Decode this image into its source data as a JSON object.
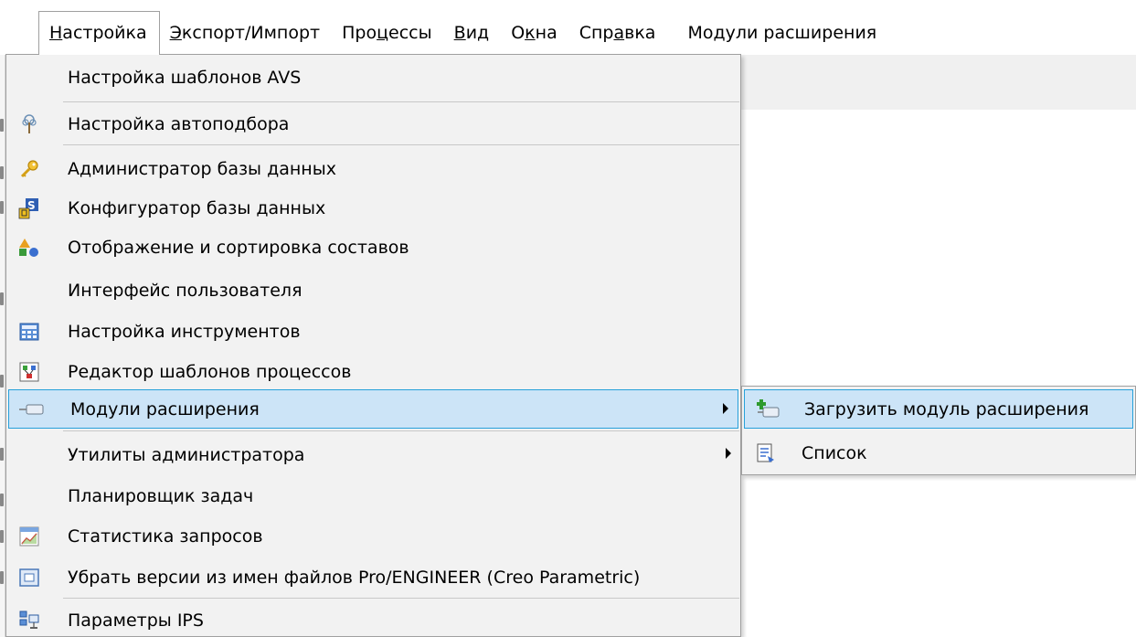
{
  "menubar": {
    "items": [
      {
        "pre": "",
        "mnemonic": "Н",
        "post": "астройка"
      },
      {
        "pre": "",
        "mnemonic": "Э",
        "post": "кспорт/Импорт"
      },
      {
        "pre": "Про",
        "mnemonic": "ц",
        "post": "ессы"
      },
      {
        "pre": "",
        "mnemonic": "В",
        "post": "ид"
      },
      {
        "pre": "О",
        "mnemonic": "к",
        "post": "на"
      },
      {
        "pre": "Спр",
        "mnemonic": "а",
        "post": "вка"
      },
      {
        "pre": "Модули расширения",
        "mnemonic": "",
        "post": ""
      }
    ]
  },
  "dropdown": {
    "items": [
      {
        "label": "Настройка шаблонов AVS",
        "icon": "none"
      },
      {
        "label": "Настройка автоподбора",
        "icon": "tree-icon"
      },
      {
        "label": "Администратор базы данных",
        "icon": "key-icon"
      },
      {
        "label": "Конфигуратор базы данных",
        "icon": "db-config-icon"
      },
      {
        "label": "Отображение и сортировка составов",
        "icon": "shapes-icon"
      },
      {
        "label": "Интерфейс пользователя",
        "icon": "none"
      },
      {
        "label": "Настройка инструментов",
        "icon": "calculator-icon"
      },
      {
        "label": "Редактор шаблонов процессов",
        "icon": "process-template-icon"
      },
      {
        "label": "Модули расширения",
        "icon": "plugin-icon"
      },
      {
        "label": "Утилиты администратора",
        "icon": "none"
      },
      {
        "label": "Планировщик задач",
        "icon": "none"
      },
      {
        "label": "Статистика запросов",
        "icon": "stats-icon"
      },
      {
        "label": "Убрать версии из имен файлов Pro/ENGINEER (Creo Parametric)",
        "icon": "window-icon"
      },
      {
        "label": "Параметры IPS",
        "icon": "network-icon"
      }
    ]
  },
  "submenu": {
    "items": [
      {
        "label": "Загрузить модуль расширения",
        "icon": "load-plugin-icon"
      },
      {
        "label": "Список",
        "icon": "list-icon"
      }
    ]
  },
  "colors": {
    "highlight_bg": "#cce4f7",
    "highlight_border": "#26a0da",
    "menu_bg": "#f2f2f2"
  }
}
